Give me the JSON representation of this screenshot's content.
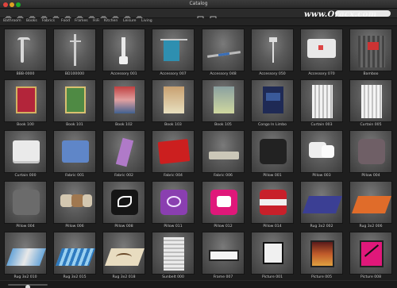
{
  "window": {
    "title": "Catalog"
  },
  "toolbar": {
    "search_value": ""
  },
  "watermark": "www.Oracx.com",
  "tabs": [
    "Bathroom",
    "Books",
    "Fabrics",
    "Food",
    "Frames",
    "HiFi",
    "Kitchen",
    "Leisure",
    "Living"
  ],
  "items": [
    "BBB-0000",
    "BD100000",
    "Accessory 001",
    "Accessory 007",
    "Accessory 048",
    "Accessory 050",
    "Accessory 070",
    "Bamboo",
    "Book 100",
    "Book 101",
    "Book 102",
    "Book 103",
    "Book 105",
    "Congo In Limbo",
    "Curtain 003",
    "Curtain 005",
    "Curtain 000",
    "Fabric 001",
    "Fabric 002",
    "Fabric 004",
    "Fabric 006",
    "Pillow 001",
    "Pillow 003",
    "Pillow 004",
    "Pillow 004",
    "Pillow 006",
    "Pillow 008",
    "Pillow 011",
    "Pillow 012",
    "Pillow 014",
    "Rug 3x2 002",
    "Rug 3x2 006",
    "Rug 3x2 010",
    "Rug 3x2 015",
    "Rug 3x2 018",
    "Sunbelt 000",
    "Frame 007",
    "Picture 001",
    "Picture 005",
    "Picture 008"
  ],
  "zoom_slider": {
    "value": 0.5
  },
  "colors": {
    "accent_magenta": "#e0187a",
    "accent_red": "#c8202a",
    "purple": "#8a3fb0"
  }
}
